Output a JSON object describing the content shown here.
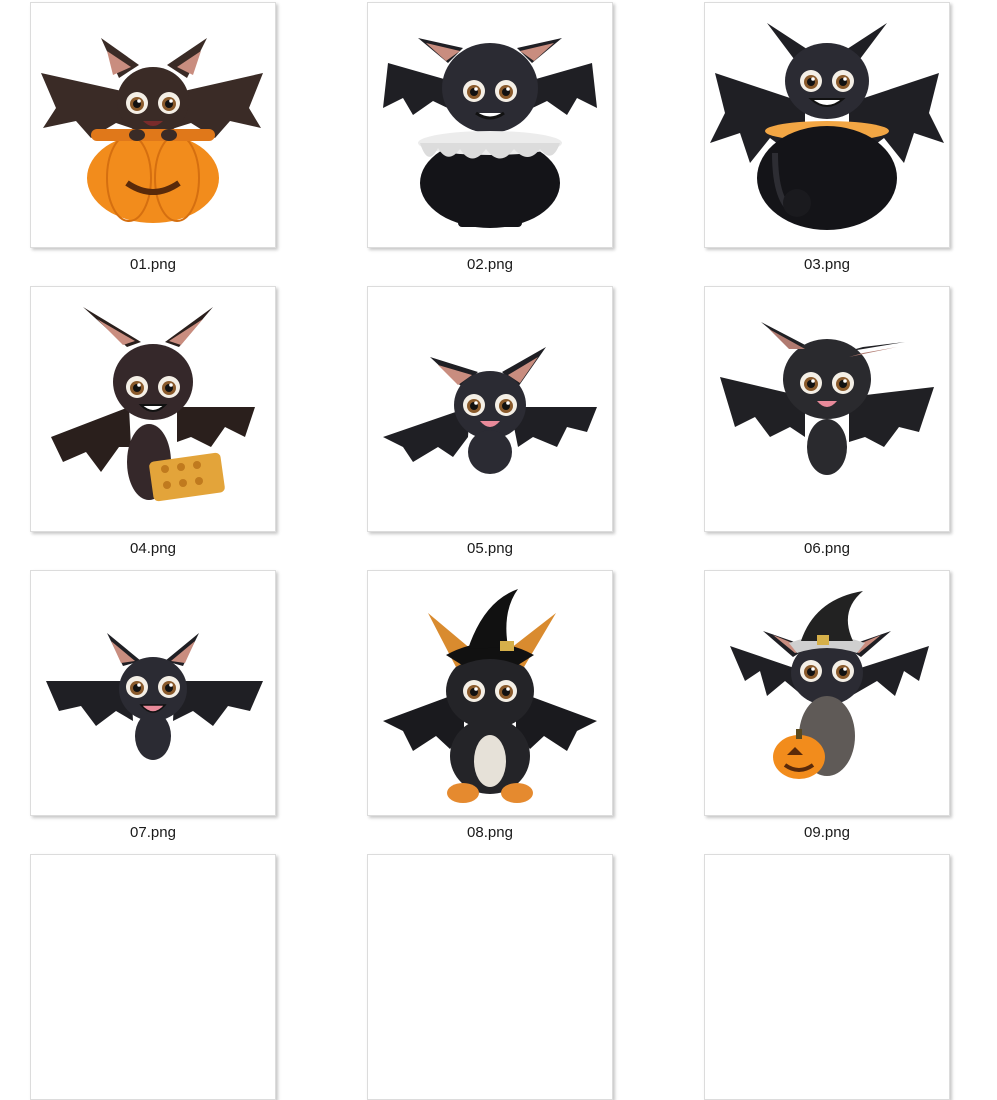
{
  "files": [
    {
      "name": "01.png",
      "thumbnail": "bat-in-pumpkin-icon"
    },
    {
      "name": "02.png",
      "thumbnail": "bat-in-cauldron-icon"
    },
    {
      "name": "03.png",
      "thumbnail": "bat-on-cauldron-icon"
    },
    {
      "name": "04.png",
      "thumbnail": "bat-with-cracker-icon"
    },
    {
      "name": "05.png",
      "thumbnail": "flying-bat-icon"
    },
    {
      "name": "06.png",
      "thumbnail": "fuzzy-flying-bat-icon"
    },
    {
      "name": "07.png",
      "thumbnail": "smiling-bat-icon"
    },
    {
      "name": "08.png",
      "thumbnail": "bat-cat-witch-hat-icon"
    },
    {
      "name": "09.png",
      "thumbnail": "witch-bat-with-pumpkin-icon"
    }
  ],
  "colors": {
    "background": "#ffffff",
    "bat_dark": "#1f1f24",
    "bat_brown": "#3a2b26",
    "pumpkin": "#f28c1c",
    "ear_inner": "#c98d7f"
  }
}
